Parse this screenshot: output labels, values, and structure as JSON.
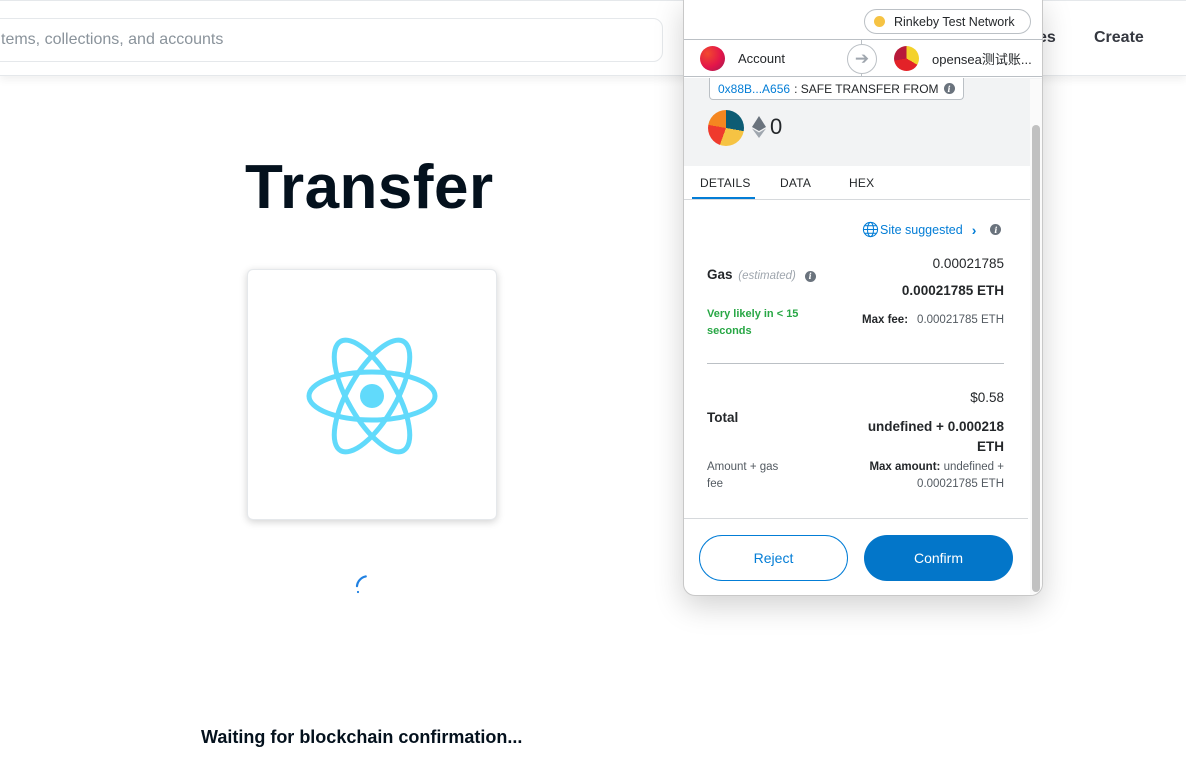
{
  "opensea": {
    "search_placeholder": "tems, collections, and accounts",
    "nav_partial": "es",
    "nav_create": "Create",
    "title": "Transfer",
    "status": "Waiting for blockchain confirmation..."
  },
  "metamask": {
    "network": "Rinkeby Test Network",
    "from_account": "Account",
    "to_account": "opensea测试账...",
    "method_address": "0x88B...A656",
    "method_name": ": SAFE TRANSFER FROM",
    "amount": "0",
    "tabs": [
      "DETAILS",
      "DATA",
      "HEX"
    ],
    "site_suggested": "Site suggested",
    "gas": {
      "label": "Gas",
      "estimated": "(estimated)",
      "fee": "0.00021785",
      "fee_eth": "0.00021785 ETH",
      "likely": "Very likely in < 15 seconds",
      "max_fee_label": "Max fee:",
      "max_fee": "0.00021785 ETH"
    },
    "total": {
      "usd": "$0.58",
      "label": "Total",
      "value": "undefined + 0.000218 ETH",
      "amount_gas": "Amount + gas fee",
      "max_amount_label": "Max amount:",
      "max_amount": "undefined + 0.00021785 ETH"
    },
    "buttons": {
      "reject": "Reject",
      "confirm": "Confirm"
    }
  },
  "colors": {
    "accent": "#037dd6",
    "confirm_bg": "#0376c9",
    "success": "#28a745",
    "react_logo": "#61dafb"
  }
}
